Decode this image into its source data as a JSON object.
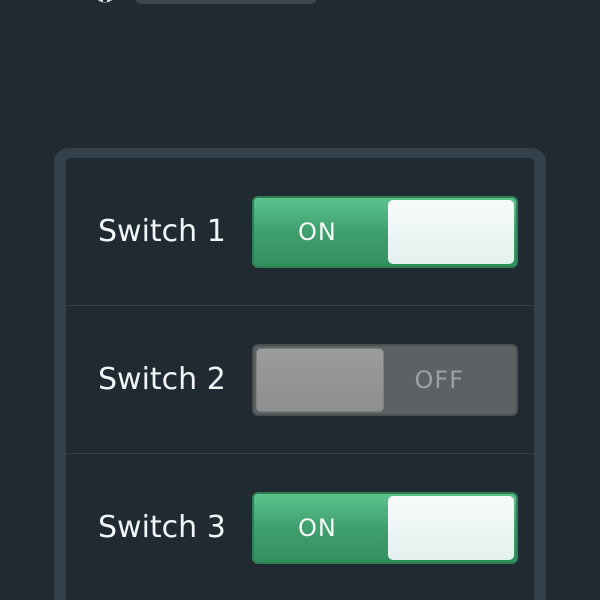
{
  "switches": [
    {
      "label": "Switch 1",
      "state": "on",
      "state_label": "ON"
    },
    {
      "label": "Switch 2",
      "state": "off",
      "state_label": "OFF"
    },
    {
      "label": "Switch 3",
      "state": "on",
      "state_label": "ON"
    }
  ],
  "header": {
    "icon": "app-logo-icon"
  },
  "colors": {
    "background": "#1f2a32",
    "panel_border": "#35414a",
    "on_green": "#3f9f6d",
    "off_gray": "#5c6164"
  }
}
